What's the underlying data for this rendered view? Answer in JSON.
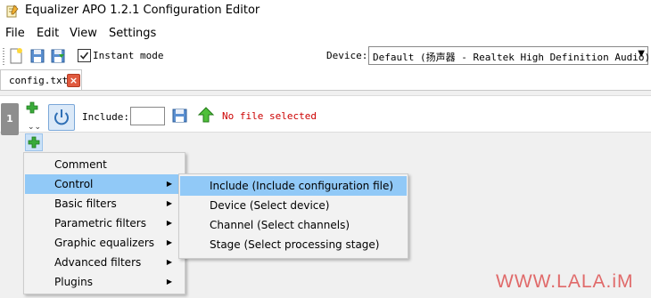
{
  "window": {
    "title": "Equalizer APO 1.2.1 Configuration Editor"
  },
  "menubar": {
    "items": [
      "File",
      "Edit",
      "View",
      "Settings"
    ]
  },
  "toolbar": {
    "instant_mode_label": "Instant mode",
    "instant_mode_checked": true,
    "device_label": "Device:",
    "device_value": "Default (扬声器 - Realtek High Definition Audio)"
  },
  "tabs": [
    {
      "label": "config.txt",
      "close_symbol": "×"
    }
  ],
  "filter_row": {
    "number": "1",
    "include_label": "Include:",
    "include_value": "",
    "status_text": "No file selected"
  },
  "context_menu": {
    "items": [
      {
        "label": "Comment",
        "submenu": false
      },
      {
        "label": "Control",
        "submenu": true,
        "selected": true
      },
      {
        "label": "Basic filters",
        "submenu": true
      },
      {
        "label": "Parametric filters",
        "submenu": true
      },
      {
        "label": "Graphic equalizers",
        "submenu": true
      },
      {
        "label": "Advanced filters",
        "submenu": true
      },
      {
        "label": "Plugins",
        "submenu": true
      }
    ]
  },
  "submenu": {
    "items": [
      {
        "label": "Include (Include configuration file)",
        "selected": true
      },
      {
        "label": "Device (Select device)"
      },
      {
        "label": "Channel (Select channels)"
      },
      {
        "label": "Stage (Select processing stage)"
      }
    ]
  },
  "watermark": "WWW.LALA.iM",
  "colors": {
    "accent_highlight": "#91c9f7",
    "error_text": "#cc0000",
    "add_icon_green": "#2fa52f",
    "tab_close_red": "#e05a3f"
  }
}
